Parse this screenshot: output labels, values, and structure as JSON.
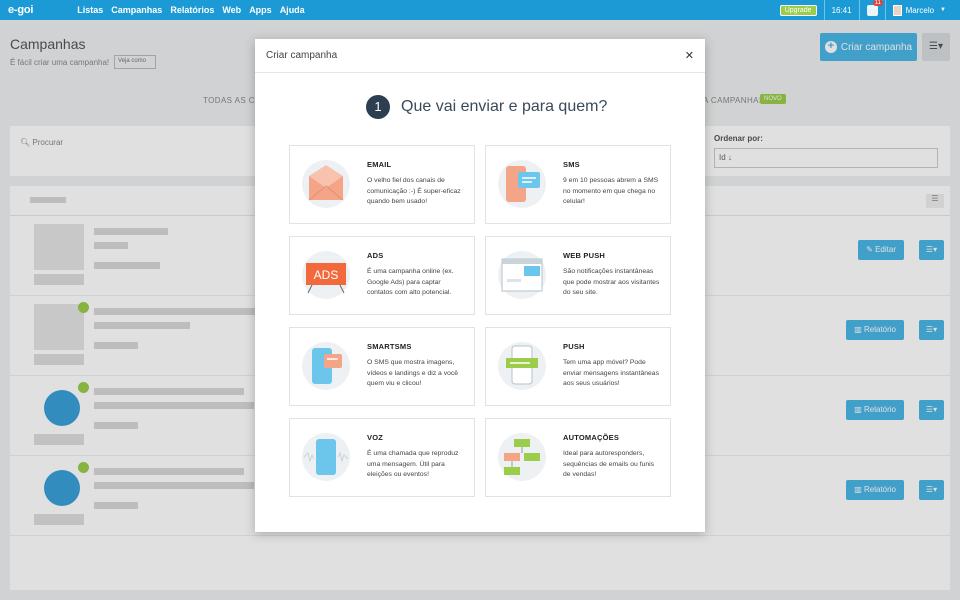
{
  "topbar": {
    "logo": "e-goi",
    "nav": [
      "Listas",
      "Campanhas",
      "Relatórios",
      "Web",
      "Apps",
      "Ajuda"
    ],
    "upgrade": "Upgrade",
    "time": "16:41",
    "notifications": "11",
    "user": "Marcelo"
  },
  "page": {
    "title": "Campanhas",
    "subtitle": "É fácil criar uma campanha!",
    "video_btn": "Veja como",
    "create_btn": "Criar campanha",
    "tab_all": "TODAS AS CAM",
    "tab_right": "A CAMPANHAS",
    "novo_badge": "NOVO",
    "search_placeholder": "Procurar",
    "order_label": "Ordenar por:",
    "order_value": "Id",
    "row_buttons": [
      "Editar",
      "Relatório",
      "Relatório",
      "Relatório"
    ]
  },
  "modal": {
    "title": "Criar campanha",
    "step_number": "1",
    "step_question": "Que vai enviar e para quem?",
    "cards": [
      {
        "icon": "email-envelope-icon",
        "title": "EMAIL",
        "desc": "O velho fiel dos canais de comunicação :-) É super-eficaz quando bem usado!"
      },
      {
        "icon": "sms-phone-icon",
        "title": "SMS",
        "desc": "9 em 10 pessoas abrem a SMS no momento em que chega no celular!"
      },
      {
        "icon": "ads-icon",
        "title": "ADS",
        "desc": "É uma campanha online (ex. Google Ads) para captar contatos com alto potencial.",
        "icon_text": "ADS"
      },
      {
        "icon": "web-push-browser-icon",
        "title": "WEB PUSH",
        "desc": "São notificações instantâneas que pode mostrar aos visitantes do seu site."
      },
      {
        "icon": "smartsms-phone-icon",
        "title": "SMARTSMS",
        "desc": "O SMS que mostra imagens, vídeos e landings e diz a você quem viu e clicou!"
      },
      {
        "icon": "push-mobile-icon",
        "title": "PUSH",
        "desc": "Tem uma app móvel? Pode enviar mensagens instantâneas aos seus usuários!"
      },
      {
        "icon": "voice-phone-icon",
        "title": "VOZ",
        "desc": "É uma chamada que reproduz uma mensagem. Útil para eleições ou eventos!"
      },
      {
        "icon": "automation-flow-icon",
        "title": "AUTOMAÇÕES",
        "desc": "Ideal para autoresponders, sequências de emails ou funis de vendas!"
      }
    ]
  },
  "colors": {
    "topbar": "#1c9ad6",
    "primary": "#4ab7e6",
    "badge_green": "#9bcc4a",
    "step_circle": "#2c3e50"
  }
}
